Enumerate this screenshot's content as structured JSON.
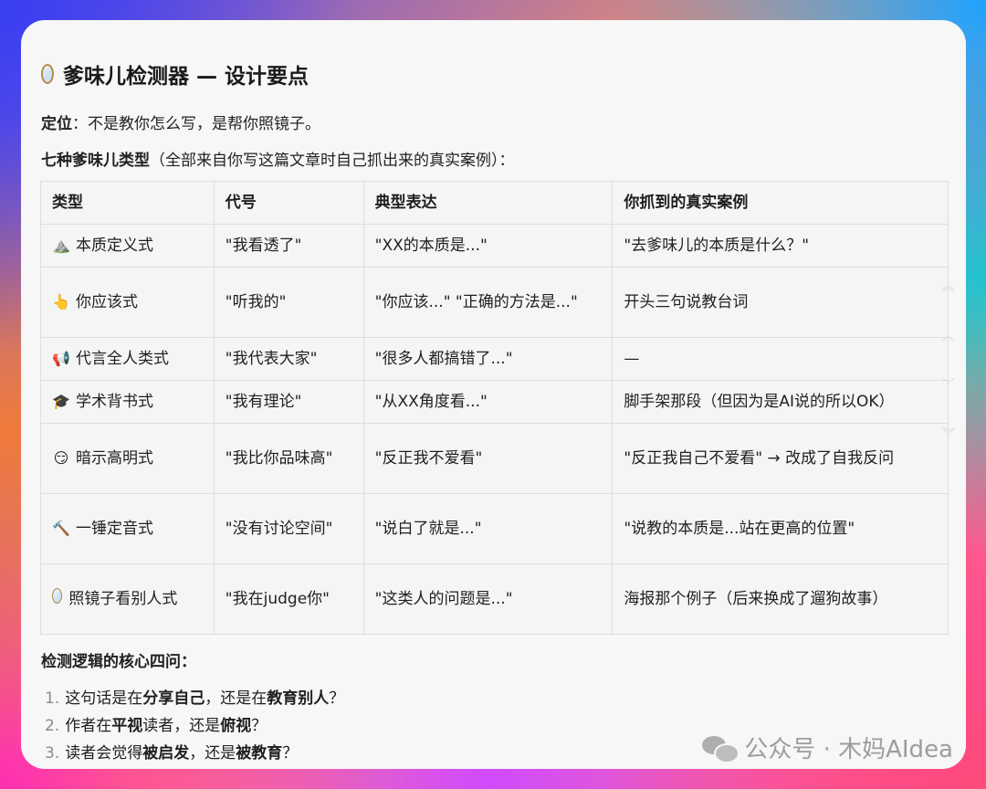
{
  "title": "爹味儿检测器 — 设计要点",
  "positioning": {
    "label": "定位",
    "text": "：不是教你怎么写，是帮你照镜子。"
  },
  "types_intro": {
    "label": "七种爹味儿类型",
    "text": "（全部来自你写这篇文章时自己抓出来的真实案例）："
  },
  "table": {
    "headers": [
      "类型",
      "代号",
      "典型表达",
      "你抓到的真实案例"
    ],
    "rows": [
      {
        "emoji": "⛰️",
        "type": "本质定义式",
        "code": "\"我看透了\"",
        "expr": "\"XX的本质是...\"",
        "case": "\"去爹味儿的本质是什么？\""
      },
      {
        "emoji": "👆",
        "type": "你应该式",
        "code": "\"听我的\"",
        "expr": "\"你应该...\" \"正确的方法是...\"",
        "case": "开头三句说教台词"
      },
      {
        "emoji": "📢",
        "type": "代言全人类式",
        "code": "\"我代表大家\"",
        "expr": "\"很多人都搞错了...\"",
        "case": "—"
      },
      {
        "emoji": "🎓",
        "type": "学术背书式",
        "code": "\"我有理论\"",
        "expr": "\"从XX角度看...\"",
        "case": "脚手架那段（但因为是AI说的所以OK）"
      },
      {
        "emoji": "😏",
        "type": "暗示高明式",
        "code": "\"我比你品味高\"",
        "expr": "\"反正我不爱看\"",
        "case": "\"反正我自己不爱看\" → 改成了自我反问"
      },
      {
        "emoji": "🔨",
        "type": "一锤定音式",
        "code": "\"没有讨论空间\"",
        "expr": "\"说白了就是...\"",
        "case": "\"说教的本质是...站在更高的位置\""
      },
      {
        "emoji": "mirror",
        "type": "照镜子看别人式",
        "code": "\"我在judge你\"",
        "expr": "\"这类人的问题是...\"",
        "case": "海报那个例子（后来换成了遛狗故事）"
      }
    ]
  },
  "logic_title": "检测逻辑的核心四问：",
  "questions": [
    {
      "num": "1.",
      "a": "这句话是在",
      "b": "分享自己",
      "c": "，还是在",
      "d": "教育别人",
      "e": "？"
    },
    {
      "num": "2.",
      "a": "作者在",
      "b": "平视",
      "c": "读者，还是",
      "d": "俯视",
      "e": "？"
    },
    {
      "num": "3.",
      "a": "读者会觉得",
      "b": "被启发",
      "c": "，还是",
      "d": "被教育",
      "e": "？"
    }
  ],
  "watermark": {
    "text": "公众号 · 木妈AIdea",
    "icon": "wechat-icon"
  }
}
